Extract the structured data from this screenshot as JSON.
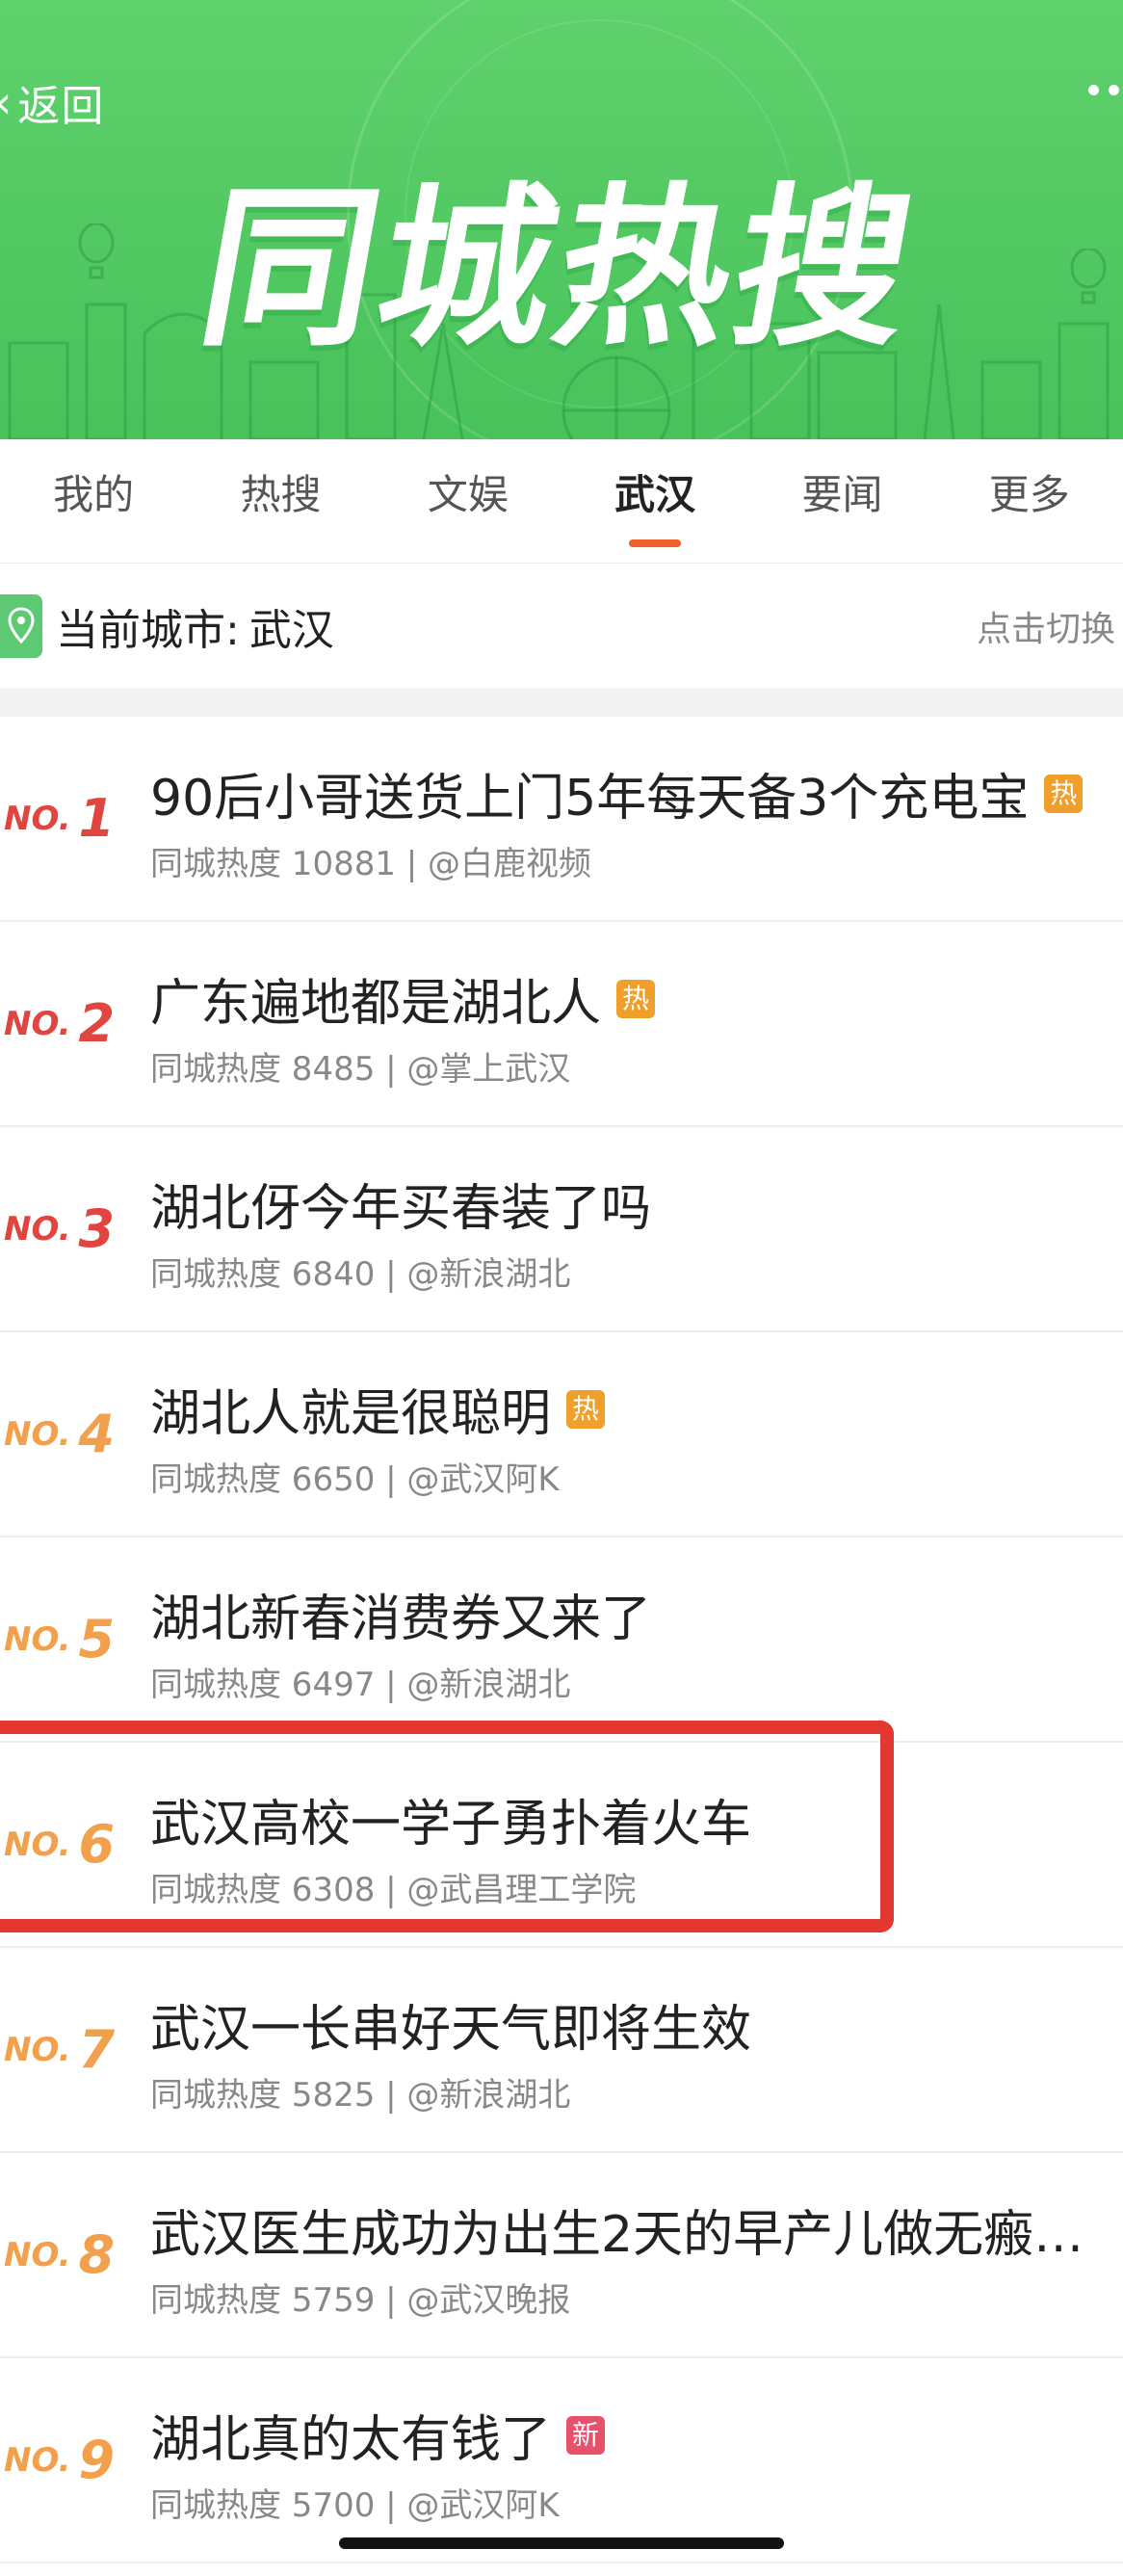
{
  "header": {
    "back_label": "返回",
    "banner_title": "同城热搜"
  },
  "tabs": [
    {
      "label": "我的",
      "active": false
    },
    {
      "label": "热搜",
      "active": false
    },
    {
      "label": "文娱",
      "active": false
    },
    {
      "label": "武汉",
      "active": true
    },
    {
      "label": "要闻",
      "active": false
    },
    {
      "label": "更多",
      "active": false
    }
  ],
  "city_bar": {
    "prefix": "当前城市:",
    "city": "武汉",
    "switch_label": "点击切换"
  },
  "colors": {
    "accent": "#f1602b",
    "banner_green": "#4cc45d",
    "rank_top": "#e0463f",
    "rank_other": "#f2a04b",
    "badge_hot": "#f0a02a",
    "badge_new": "#e8516b",
    "highlight": "#e3372f"
  },
  "items": [
    {
      "rank_prefix": "NO.",
      "rank": "1",
      "title": "90后小哥送货上门5年每天备3个充电宝",
      "badge": "热",
      "badge_type": "hot",
      "meta": "同城热度 10881 | @白鹿视频"
    },
    {
      "rank_prefix": "NO.",
      "rank": "2",
      "title": "广东遍地都是湖北人",
      "badge": "热",
      "badge_type": "hot",
      "meta": "同城热度 8485 | @掌上武汉"
    },
    {
      "rank_prefix": "NO.",
      "rank": "3",
      "title": "湖北伢今年买春装了吗",
      "badge": "",
      "badge_type": "",
      "meta": "同城热度 6840 | @新浪湖北"
    },
    {
      "rank_prefix": "NO.",
      "rank": "4",
      "title": "湖北人就是很聪明",
      "badge": "热",
      "badge_type": "hot",
      "meta": "同城热度 6650 | @武汉阿K"
    },
    {
      "rank_prefix": "NO.",
      "rank": "5",
      "title": "湖北新春消费券又来了",
      "badge": "",
      "badge_type": "",
      "meta": "同城热度 6497 | @新浪湖北"
    },
    {
      "rank_prefix": "NO.",
      "rank": "6",
      "title": "武汉高校一学子勇扑着火车",
      "badge": "",
      "badge_type": "",
      "meta": "同城热度 6308 | @武昌理工学院"
    },
    {
      "rank_prefix": "NO.",
      "rank": "7",
      "title": "武汉一长串好天气即将生效",
      "badge": "",
      "badge_type": "",
      "meta": "同城热度 5825 | @新浪湖北"
    },
    {
      "rank_prefix": "NO.",
      "rank": "8",
      "title": "武汉医生成功为出生2天的早产儿做无瘢痕…",
      "badge": "",
      "badge_type": "",
      "meta": "同城热度 5759 | @武汉晚报"
    },
    {
      "rank_prefix": "NO.",
      "rank": "9",
      "title": "湖北真的太有钱了",
      "badge": "新",
      "badge_type": "new",
      "meta": "同城热度 5700 | @武汉阿K"
    }
  ]
}
